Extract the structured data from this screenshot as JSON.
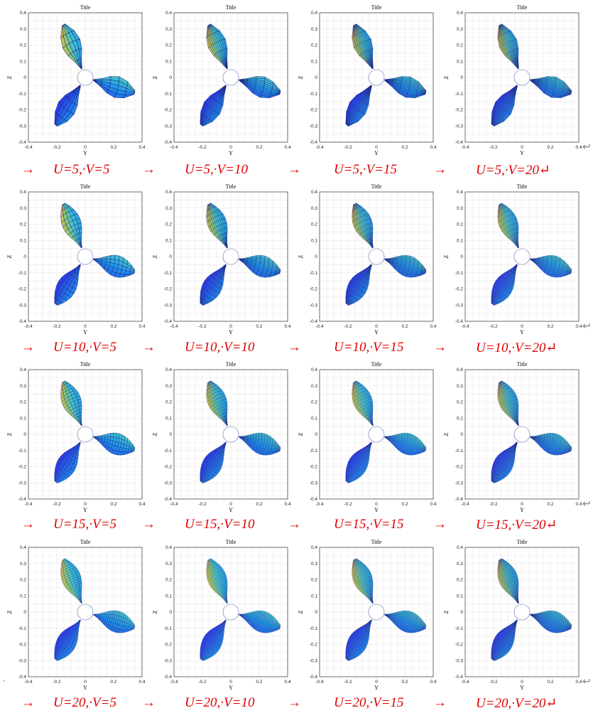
{
  "plot_title": "Title",
  "x_axis_label": "Y",
  "y_axis_label": "Z",
  "x_ticks": [
    "-0.4",
    "-0.2",
    "0",
    "0.2",
    "0.4"
  ],
  "y_ticks": [
    "0.4",
    "0.3",
    "0.2",
    "0.1",
    "0",
    "-0.1",
    "-0.2",
    "-0.3",
    "-0.4"
  ],
  "x_range": [
    -0.4,
    0.4
  ],
  "y_range": [
    -0.4,
    0.4
  ],
  "arrow_symbol": "→",
  "return_symbol": "↵",
  "left_arrow_symbol": "↩",
  "dot": "·",
  "colors": {
    "caption": "#e00000",
    "surface_low": "#2e2ee6",
    "surface_mid": "#1fa0e6",
    "surface_high": "#f2b53a",
    "mesh_line": "#1a237e"
  },
  "rows": [
    {
      "u": 5,
      "captions": [
        "U=5,·V=5",
        "U=5,·V=10",
        "U=5,·V=15",
        "U=5,·V=20↵"
      ],
      "v": [
        5,
        10,
        15,
        20
      ]
    },
    {
      "u": 10,
      "captions": [
        "U=10,·V=5",
        "U=10,·V=10",
        "U=10,·V=15",
        "U=10,·V=20↵"
      ],
      "v": [
        5,
        10,
        15,
        20
      ]
    },
    {
      "u": 15,
      "captions": [
        "U=15,·V=5",
        "U=15,·V=10",
        "U=15,·V=15",
        "U=15,·V=20↵"
      ],
      "v": [
        5,
        10,
        15,
        20
      ]
    },
    {
      "u": 20,
      "captions": [
        "U=20,·V=5",
        "U=20,·V=10",
        "U=20,·V=15",
        "U=20,·V=20↵"
      ],
      "v": [
        5,
        10,
        15,
        20
      ]
    }
  ]
}
